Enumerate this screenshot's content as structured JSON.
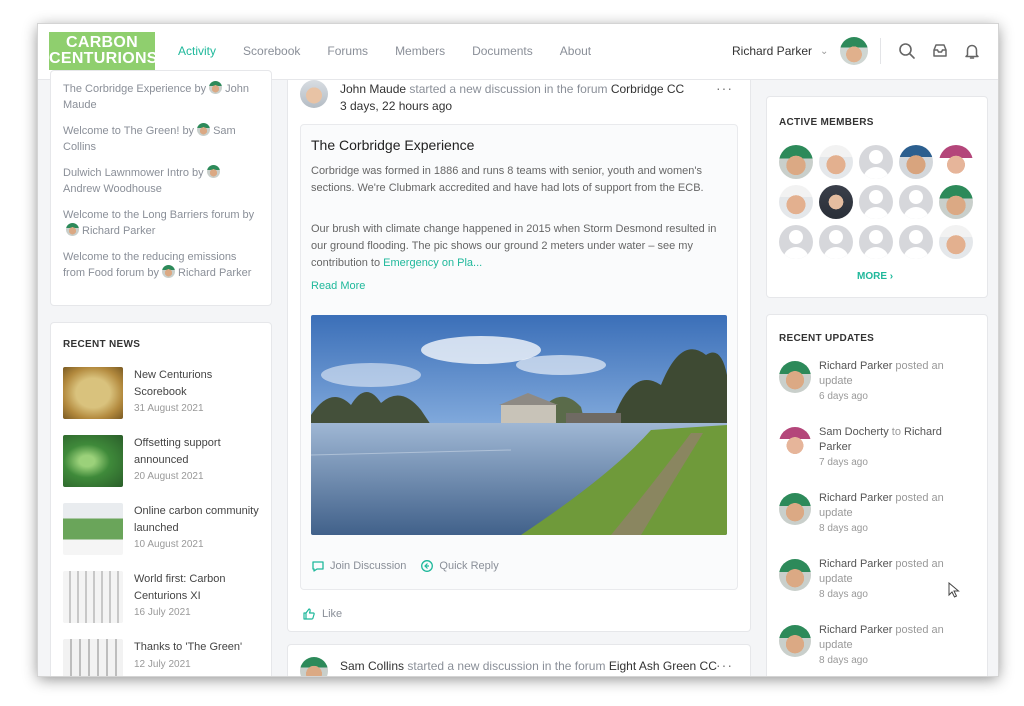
{
  "logo": {
    "line1": "CARBON",
    "line2": "CENTURIONS"
  },
  "nav": [
    {
      "label": "Activity",
      "active": true
    },
    {
      "label": "Scorebook"
    },
    {
      "label": "Forums"
    },
    {
      "label": "Members"
    },
    {
      "label": "Documents"
    },
    {
      "label": "About"
    }
  ],
  "header": {
    "user_name": "Richard Parker",
    "icons": [
      "search-icon",
      "inbox-icon",
      "bell-icon"
    ]
  },
  "discussions": [
    {
      "title": "The Corbridge Experience",
      "by": "by",
      "author": "John Maude"
    },
    {
      "title": "Welcome to The Green!",
      "by": "by",
      "author": "Sam Collins"
    },
    {
      "title": "Dulwich Lawnmower Intro",
      "by": "by",
      "author": "Andrew Woodhouse"
    },
    {
      "title": "Welcome to the Long Barriers forum",
      "by": "by",
      "author": "Richard Parker"
    },
    {
      "title": "Welcome to the reducing emissions from Food forum",
      "by": "by",
      "author": "Richard Parker"
    }
  ],
  "recent_news": {
    "title": "RECENT NEWS",
    "items": [
      {
        "title": "New Centurions Scorebook",
        "date": "31 August 2021"
      },
      {
        "title": "Offsetting support announced",
        "date": "20 August 2021"
      },
      {
        "title": "Online carbon community launched",
        "date": "10 August 2021"
      },
      {
        "title": "World first: Carbon Centurions XI",
        "date": "16 July 2021"
      },
      {
        "title": "Thanks to 'The Green'",
        "date": "12 July 2021"
      }
    ]
  },
  "post": {
    "author": "John Maude",
    "action": "started a new discussion in the forum",
    "forum": "Corbridge CC",
    "time": "3 days, 22 hours ago",
    "title": "The Corbridge Experience",
    "para1": "Corbridge was formed in 1886 and runs 8 teams with senior, youth and women's sections. We're Clubmark accredited and have had lots of support from the ECB.",
    "para2": "Our brush with climate change happened in 2015 when Storm Desmond resulted in our ground flooding. The pic shows our ground 2 meters under water – see my contribution to",
    "para2_link": "Emergency on Pla...",
    "read_more": "Read More",
    "join": "Join Discussion",
    "reply": "Quick Reply",
    "like": "Like"
  },
  "post2": {
    "author": "Sam Collins",
    "action": "started a new discussion in the forum",
    "forum": "Eight Ash Green CC"
  },
  "active_members": {
    "title": "ACTIVE MEMBERS",
    "more": "MORE"
  },
  "recent_updates": {
    "title": "RECENT UPDATES",
    "items": [
      {
        "name": "Richard Parker",
        "action": "posted an update",
        "target": "",
        "time": "6 days ago"
      },
      {
        "name": "Sam Docherty",
        "action": "to",
        "target": "Richard Parker",
        "time": "7 days ago"
      },
      {
        "name": "Richard Parker",
        "action": "posted an update",
        "target": "",
        "time": "8 days ago"
      },
      {
        "name": "Richard Parker",
        "action": "posted an update",
        "target": "",
        "time": "8 days ago"
      },
      {
        "name": "Richard Parker",
        "action": "posted an update",
        "target": "",
        "time": "8 days ago"
      }
    ]
  },
  "colors": {
    "accent": "#1fb89b",
    "logo_bg": "#8fcf6e"
  }
}
